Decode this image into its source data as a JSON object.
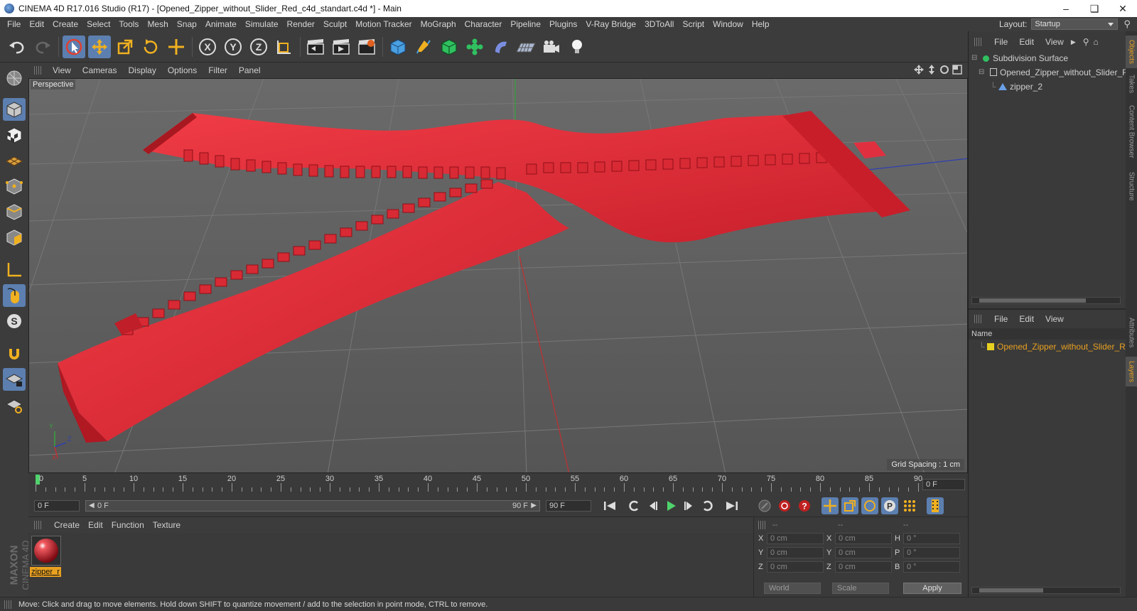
{
  "window": {
    "title": "CINEMA 4D R17.016 Studio (R17) - [Opened_Zipper_without_Slider_Red_c4d_standart.c4d *] - Main"
  },
  "menubar": [
    "File",
    "Edit",
    "Create",
    "Select",
    "Tools",
    "Mesh",
    "Snap",
    "Animate",
    "Simulate",
    "Render",
    "Sculpt",
    "Motion Tracker",
    "MoGraph",
    "Character",
    "Pipeline",
    "Plugins",
    "V-Ray Bridge",
    "3DToAll",
    "Script",
    "Window",
    "Help"
  ],
  "layout": {
    "label": "Layout:",
    "value": "Startup"
  },
  "viewport": {
    "menu": [
      "View",
      "Cameras",
      "Display",
      "Options",
      "Filter",
      "Panel"
    ],
    "label": "Perspective",
    "grid_spacing": "Grid Spacing : 1 cm",
    "axis_x": "X",
    "axis_y": "Y",
    "axis_z": "Z"
  },
  "timeline": {
    "labels": [
      "0",
      "5",
      "10",
      "15",
      "20",
      "25",
      "30",
      "35",
      "40",
      "45",
      "50",
      "55",
      "60",
      "65",
      "70",
      "75",
      "80",
      "85",
      "90"
    ],
    "current_frame": "0 F"
  },
  "transport": {
    "start_field": "0 F",
    "range_start": "0 F",
    "range_end": "90 F",
    "end_field": "90 F"
  },
  "material_manager": {
    "menu": [
      "Create",
      "Edit",
      "Function",
      "Texture"
    ],
    "material_name": "zipper_r"
  },
  "branding": {
    "maxon": "MAXON",
    "cinema": "CINEMA 4D"
  },
  "coordinates": {
    "headers": [
      "--",
      "--",
      "--"
    ],
    "rows": [
      {
        "l1": "X",
        "v1": "0 cm",
        "l2": "X",
        "v2": "0 cm",
        "l3": "H",
        "v3": "0 °"
      },
      {
        "l1": "Y",
        "v1": "0 cm",
        "l2": "Y",
        "v2": "0 cm",
        "l3": "P",
        "v3": "0 °"
      },
      {
        "l1": "Z",
        "v1": "0 cm",
        "l2": "Z",
        "v2": "0 cm",
        "l3": "B",
        "v3": "0 °"
      }
    ],
    "mode": "World",
    "scale": "Scale",
    "apply": "Apply"
  },
  "objects_panel": {
    "menu": [
      "File",
      "Edit",
      "View"
    ],
    "items": [
      "Subdivision Surface",
      "Opened_Zipper_without_Slider_R",
      "zipper_2"
    ]
  },
  "layers_panel": {
    "menu": [
      "File",
      "Edit",
      "View"
    ],
    "column": "Name",
    "layer": "Opened_Zipper_without_Slider_R"
  },
  "vertical_tabs": [
    "Objects",
    "Takes",
    "Content Browser",
    "Structure",
    "Attributes",
    "Layers"
  ],
  "status": "Move: Click and drag to move elements. Hold down SHIFT to quantize movement / add to the selection in point mode, CTRL to remove.",
  "colors": {
    "accent": "#5c7fb0",
    "highlight": "#e8a020",
    "zipper_red": "#e0303a",
    "playhead": "#4fd36c"
  }
}
